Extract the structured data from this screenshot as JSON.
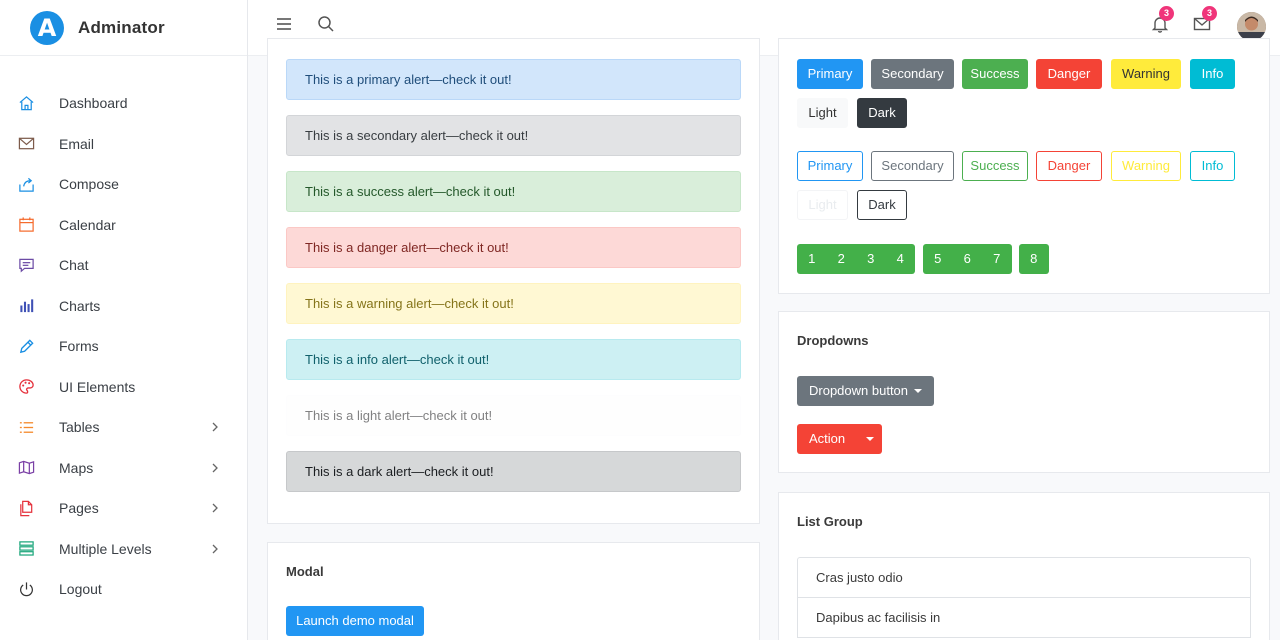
{
  "brand": {
    "name": "Adminator",
    "logo_letter": "A",
    "logo_color": "#1a8fe3"
  },
  "sidebar": {
    "items": [
      {
        "label": "Dashboard",
        "icon": "home-icon",
        "color": "#1a8fe3",
        "chevron": false
      },
      {
        "label": "Email",
        "icon": "mail-icon",
        "color": "#7d5b4b",
        "chevron": false
      },
      {
        "label": "Compose",
        "icon": "share-icon",
        "color": "#1a8fe3",
        "chevron": false
      },
      {
        "label": "Calendar",
        "icon": "calendar-icon",
        "color": "#f56b2d",
        "chevron": false
      },
      {
        "label": "Chat",
        "icon": "chat-icon",
        "color": "#6c4ba5",
        "chevron": false
      },
      {
        "label": "Charts",
        "icon": "bar-chart-icon",
        "color": "#3f51b5",
        "chevron": false
      },
      {
        "label": "Forms",
        "icon": "pencil-icon",
        "color": "#1a8fe3",
        "chevron": false
      },
      {
        "label": "UI Elements",
        "icon": "palette-icon",
        "color": "#e5323d",
        "chevron": false
      },
      {
        "label": "Tables",
        "icon": "list-icon",
        "color": "#f58a2d",
        "chevron": true
      },
      {
        "label": "Maps",
        "icon": "map-icon",
        "color": "#7a3fa5",
        "chevron": true
      },
      {
        "label": "Pages",
        "icon": "files-icon",
        "color": "#e5323d",
        "chevron": true
      },
      {
        "label": "Multiple Levels",
        "icon": "layers-icon",
        "color": "#1aa57a",
        "chevron": true
      },
      {
        "label": "Logout",
        "icon": "power-icon",
        "color": "#333333",
        "chevron": false
      }
    ]
  },
  "topbar": {
    "notifications_count": "3",
    "messages_count": "3"
  },
  "alerts": [
    {
      "text": "This is a primary alert—check it out!",
      "bg": "#d2e6fb",
      "border": "#bad8f8",
      "color": "#1f4d7a"
    },
    {
      "text": "This is a secondary alert—check it out!",
      "bg": "#e2e3e5",
      "border": "#d3d5d8",
      "color": "#383d41"
    },
    {
      "text": "This is a success alert—check it out!",
      "bg": "#d9eeda",
      "border": "#c7e6c9",
      "color": "#24582a"
    },
    {
      "text": "This is a danger alert—check it out!",
      "bg": "#fdd9d7",
      "border": "#fbc8c5",
      "color": "#7f2723"
    },
    {
      "text": "This is a warning alert—check it out!",
      "bg": "#fff8d3",
      "border": "#fff3bf",
      "color": "#85741a"
    },
    {
      "text": "This is a info alert—check it out!",
      "bg": "#cdf0f3",
      "border": "#b8eaef",
      "color": "#10606b"
    },
    {
      "text": "This is a light alert—check it out!",
      "bg": "#fefefe",
      "border": "#fdfdfe",
      "color": "#818182"
    },
    {
      "text": "This is a dark alert—check it out!",
      "bg": "#d6d8d9",
      "border": "#c6c8ca",
      "color": "#1b1e21"
    }
  ],
  "modal": {
    "title": "Modal",
    "button": "Launch demo modal"
  },
  "buttons": {
    "solid": [
      "Primary",
      "Secondary",
      "Success",
      "Danger",
      "Warning",
      "Info"
    ],
    "solid_row2": [
      "Light",
      "Dark"
    ],
    "outline": [
      "Primary",
      "Secondary",
      "Success",
      "Danger",
      "Warning",
      "Info"
    ],
    "outline_row2": [
      "Light",
      "Dark"
    ],
    "colors": {
      "primary": "#2196f3",
      "secondary": "#6c757d",
      "success": "#4caf50",
      "danger": "#f44336",
      "warning": "#ffeb3b",
      "info": "#00bcd4",
      "light": "#f8f9fa",
      "dark": "#343a40"
    }
  },
  "pagination": {
    "group1": [
      "1",
      "2",
      "3",
      "4"
    ],
    "group2": [
      "5",
      "6",
      "7"
    ],
    "group3": [
      "8"
    ]
  },
  "dropdowns": {
    "title": "Dropdowns",
    "button": "Dropdown button",
    "split_button": "Action"
  },
  "list_group": {
    "title": "List Group",
    "items": [
      "Cras justo odio",
      "Dapibus ac facilisis in"
    ]
  }
}
